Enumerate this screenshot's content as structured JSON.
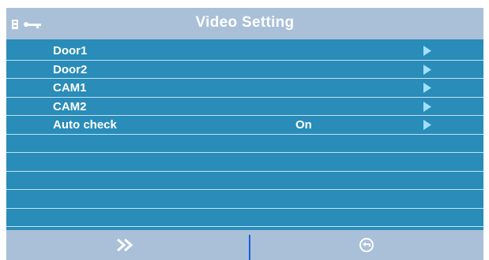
{
  "header": {
    "title": "Video Setting",
    "icons": [
      "sd-card-icon",
      "key-icon"
    ]
  },
  "menu": {
    "items": [
      {
        "label": "Door1",
        "value": ""
      },
      {
        "label": "Door2",
        "value": ""
      },
      {
        "label": "CAM1",
        "value": ""
      },
      {
        "label": "CAM2",
        "value": ""
      },
      {
        "label": "Auto check",
        "value": "On"
      }
    ],
    "empty_rows": 5
  },
  "footer": {
    "left_icon": "double-chevron-right-icon",
    "right_icon": "return-icon"
  },
  "colors": {
    "panel": "#2a8cb8",
    "bar": "#a9c0d8",
    "arrow": "#9fe0ff",
    "divider": "#1a5ce0"
  }
}
